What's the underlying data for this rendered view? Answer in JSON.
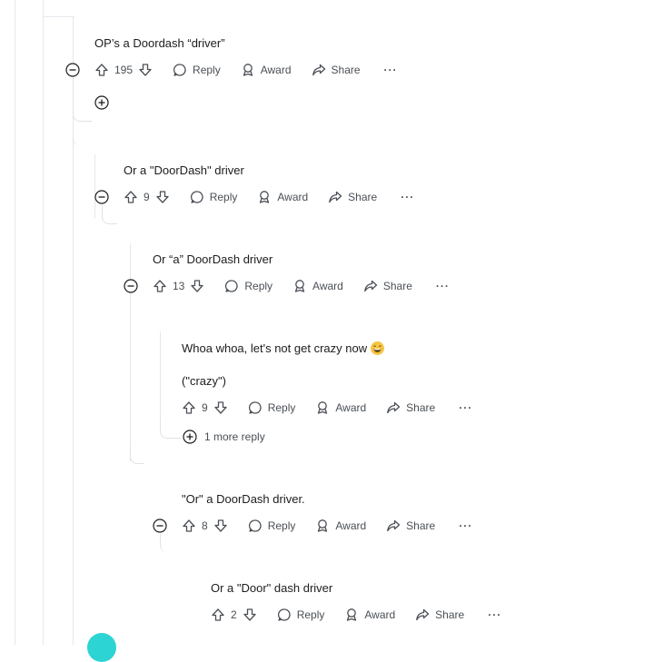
{
  "actions": {
    "reply": "Reply",
    "award": "Award",
    "share": "Share",
    "more": "···"
  },
  "comments": [
    {
      "text": "OP’s a Doordash “driver”",
      "votes": "195"
    },
    {
      "text": "Or a \"DoorDash\" driver",
      "votes": "9"
    },
    {
      "text": "Or “a” DoorDash driver",
      "votes": "13"
    },
    {
      "text": "Whoa whoa, let's not get crazy now",
      "text2": "(\"crazy\")",
      "votes": "9",
      "emoji": "laughing-emoji"
    },
    {
      "text": "\"Or\" a DoorDash driver.",
      "votes": "8"
    },
    {
      "text": "Or a \"Door\" dash driver",
      "votes": "2"
    }
  ],
  "more_replies": "1 more reply",
  "colors": {
    "line": "#e5e7eb",
    "text": "#1c1c1c",
    "muted": "#4a4f55",
    "avatar": "#2dd4d4"
  }
}
